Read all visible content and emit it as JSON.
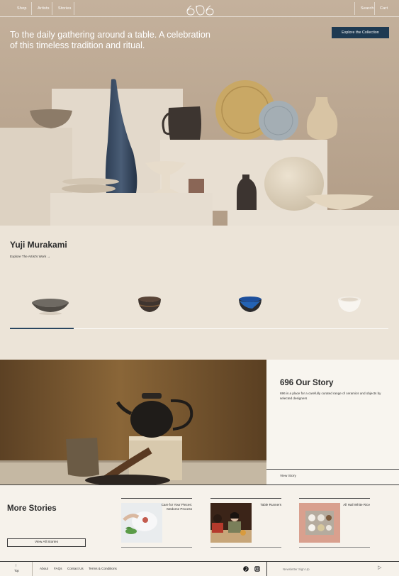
{
  "nav": {
    "left": [
      "Shop",
      "Artists",
      "Stories"
    ],
    "right": [
      "Search",
      "Cart"
    ],
    "logo": "696"
  },
  "hero": {
    "headline": "To the daily gathering around a table. A celebration of this timeless tradition and ritual.",
    "cta": "Explore the Collection"
  },
  "artist": {
    "name": "Yuji Murakami",
    "link": "Explore The Artist's Work →",
    "active_index": 0,
    "item_count": 4
  },
  "story": {
    "title": "696 Our Story",
    "description": "696 is a place for a carefully curated range of ceramics and objects by selected designers",
    "link": "View Story"
  },
  "more_stories": {
    "title": "More Stories",
    "button": "View All Stories",
    "cards": [
      {
        "title": "Care for Your Pieces: Medome Process"
      },
      {
        "title": "Table Runners"
      },
      {
        "title": "All Hail White Rice"
      }
    ]
  },
  "footer": {
    "top_label": "Top",
    "links": [
      "About",
      "FAQs",
      "Contact Us",
      "Terms & Conditions"
    ],
    "newsletter_placeholder": "Newsletter Sign Up",
    "social": [
      "pinterest-icon",
      "instagram-icon"
    ]
  },
  "colors": {
    "accent": "#1e3a52",
    "artist_bg": "#ece4d8",
    "page_bg": "#f6f2eb"
  }
}
